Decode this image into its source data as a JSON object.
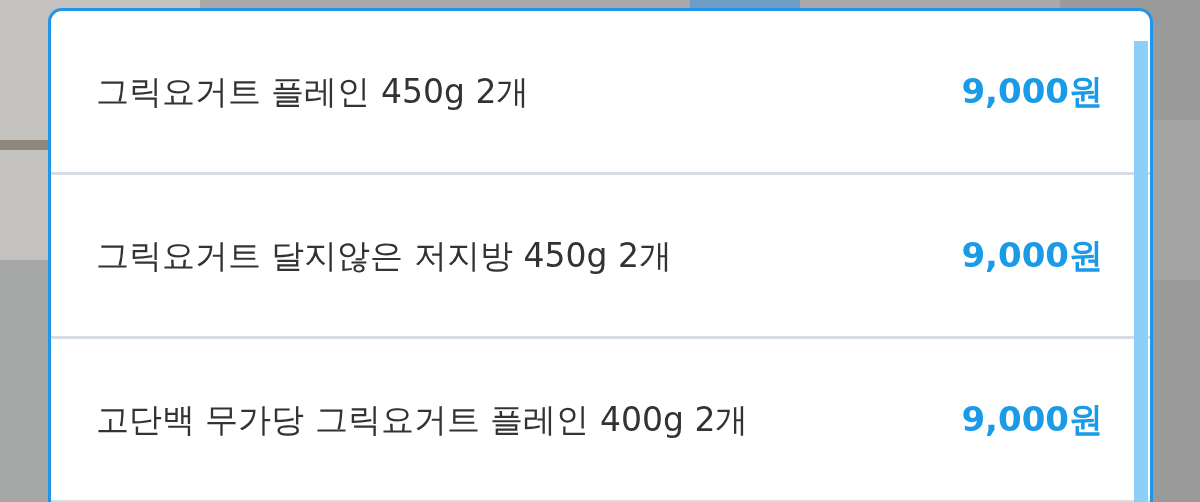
{
  "options": [
    {
      "name": "그릭요거트 플레인 450g 2개",
      "price": "9,000원"
    },
    {
      "name": "그릭요거트 달지않은 저지방 450g 2개",
      "price": "9,000원"
    },
    {
      "name": "고단백 무가당 그릭요거트 플레인 400g 2개",
      "price": "9,000원"
    }
  ]
}
